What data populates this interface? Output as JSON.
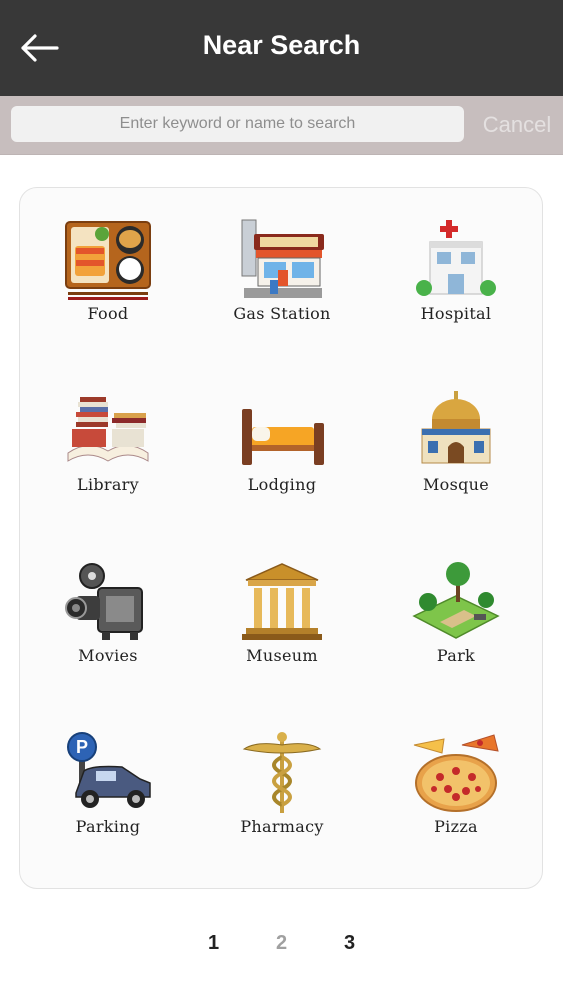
{
  "header": {
    "title": "Near Search",
    "back_icon": "arrow-left-icon"
  },
  "search": {
    "placeholder": "Enter keyword or name to search",
    "value": "",
    "cancel_label": "Cancel"
  },
  "categories": [
    {
      "label": "Food",
      "icon": "food-tray-icon"
    },
    {
      "label": "Gas Station",
      "icon": "gas-station-icon"
    },
    {
      "label": "Hospital",
      "icon": "hospital-icon"
    },
    {
      "label": "Library",
      "icon": "books-icon"
    },
    {
      "label": "Lodging",
      "icon": "bed-icon"
    },
    {
      "label": "Mosque",
      "icon": "mosque-icon"
    },
    {
      "label": "Movies",
      "icon": "film-camera-icon"
    },
    {
      "label": "Museum",
      "icon": "museum-icon"
    },
    {
      "label": "Park",
      "icon": "park-icon"
    },
    {
      "label": "Parking",
      "icon": "parking-car-icon"
    },
    {
      "label": "Pharmacy",
      "icon": "caduceus-icon"
    },
    {
      "label": "Pizza",
      "icon": "pizza-icon"
    }
  ],
  "pagination": {
    "pages": [
      "1",
      "2",
      "3"
    ],
    "current": "2"
  },
  "colors": {
    "header_bg": "#383838",
    "search_bar_bg": "#c7bebe",
    "panel_bg": "#fbfbfb"
  }
}
